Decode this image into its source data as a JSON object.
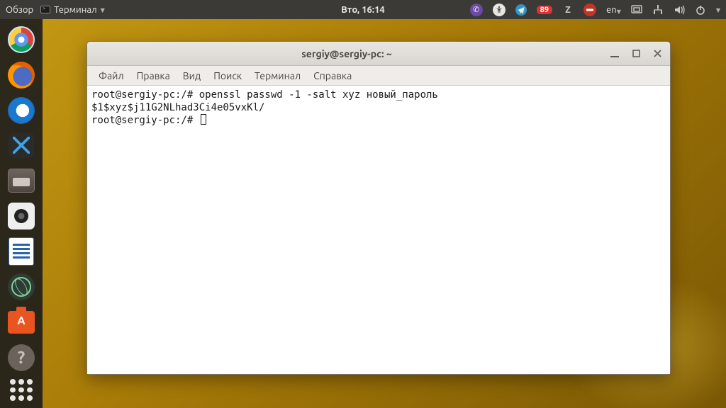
{
  "panel": {
    "activities": "Обзор",
    "active_app": "Терминал",
    "clock": "Вто, 16:14",
    "update_badge": "89",
    "lang": "en"
  },
  "dock": {
    "items": [
      "chromium",
      "firefox",
      "thunderbird",
      "vscode",
      "files",
      "camera",
      "writer",
      "atom",
      "software",
      "help"
    ]
  },
  "window": {
    "title": "sergiy@sergiy-pc: ~",
    "menu": {
      "file": "Файл",
      "edit": "Правка",
      "view": "Вид",
      "search": "Поиск",
      "terminal": "Терминал",
      "help": "Справка"
    },
    "terminal": {
      "line1": "root@sergiy-pc:/# openssl passwd -1 -salt xyz новый_пароль",
      "line2": "$1$xyz$j11G2NLhad3Ci4e05vxKl/",
      "line3": "root@sergiy-pc:/# "
    }
  }
}
